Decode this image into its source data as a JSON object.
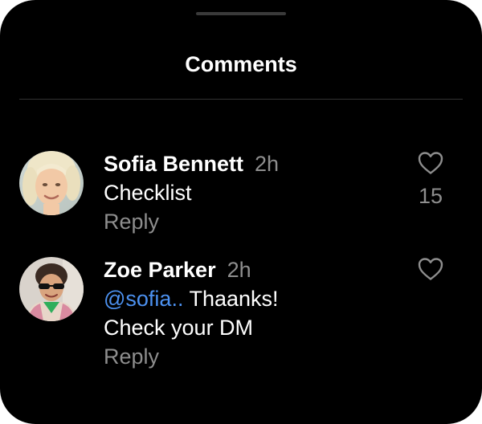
{
  "sheet": {
    "title": "Comments"
  },
  "comments": [
    {
      "author": "Sofia Bennett",
      "time": "2h",
      "mention": "",
      "text": "Checklist",
      "text_line2": "",
      "reply_label": "Reply",
      "like_count": "15",
      "avatar": "sofia-avatar"
    },
    {
      "author": "Zoe Parker",
      "time": "2h",
      "mention": "@sofia..",
      "text": " Thaanks!",
      "text_line2": "Check your DM",
      "reply_label": "Reply",
      "like_count": "",
      "avatar": "zoe-avatar"
    }
  ],
  "colors": {
    "background": "#000000",
    "primary_text": "#ffffff",
    "secondary_text": "#8e8e8e",
    "mention": "#4c91f0",
    "divider": "#333333"
  },
  "icons": {
    "like": "heart-outline-icon",
    "grabber": "drag-handle"
  }
}
